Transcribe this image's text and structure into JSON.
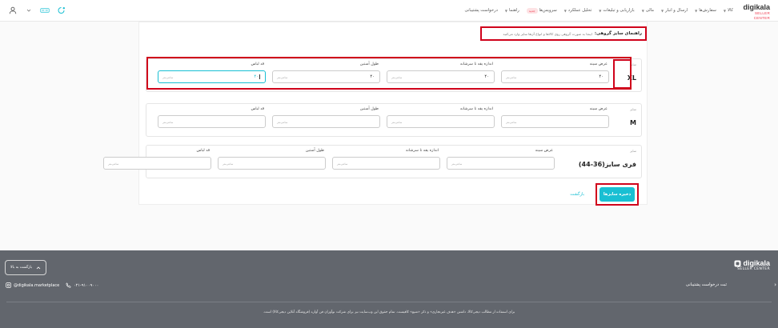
{
  "header": {
    "logo_main": "digikala",
    "logo_sub": "SELLER CENTER",
    "nav": [
      {
        "label": "کالا",
        "chevron": true
      },
      {
        "label": "سفارش‌ها",
        "chevron": true
      },
      {
        "label": "ارسال و انبار",
        "chevron": true
      },
      {
        "label": "مالی",
        "chevron": true
      },
      {
        "label": "بازاریابی و تبلیغات",
        "chevron": true
      },
      {
        "label": "تحلیل عملکرد",
        "chevron": true
      },
      {
        "label": "سرویس‌ها",
        "chevron": false,
        "badge": "جدید"
      },
      {
        "label": "راهنما",
        "chevron": true
      },
      {
        "label": "درخواست پشتیبانی",
        "chevron": false
      }
    ]
  },
  "guide": {
    "title": "راهنمای سایز گروهی:",
    "description": "اینجا به صورت گروهی روی کالاها و انواع آن‌ها سایز وارد می‌کنید"
  },
  "size_caption": "سایز",
  "unit": "سانتی‌متر",
  "sizes": [
    {
      "value": "XL",
      "fields": [
        {
          "label": "عرض سینه",
          "value": "۴۰"
        },
        {
          "label": "اندازه یقه تا سرشانه",
          "value": "۴۰"
        },
        {
          "label": "طول آستین",
          "value": "۴۰"
        },
        {
          "label": "قد لباس",
          "value": "۴۰"
        }
      ]
    },
    {
      "value": "M",
      "fields": [
        {
          "label": "عرض سینه",
          "value": ""
        },
        {
          "label": "اندازه یقه تا سرشانه",
          "value": ""
        },
        {
          "label": "طول آستین",
          "value": ""
        },
        {
          "label": "قد لباس",
          "value": ""
        }
      ]
    },
    {
      "value": "فری سایز(36-44)",
      "fields": [
        {
          "label": "عرض سینه",
          "value": ""
        },
        {
          "label": "اندازه یقه تا سرشانه",
          "value": ""
        },
        {
          "label": "طول آستین",
          "value": ""
        },
        {
          "label": "قد لباس",
          "value": ""
        }
      ]
    }
  ],
  "actions": {
    "save": "ذخیره سایزها",
    "back": "بازگشت"
  },
  "footer": {
    "logo_main": "digikala",
    "logo_sub": "SELLER CENTER",
    "back_to_top": "بازگشت به بالا",
    "support_request": "ثبت درخواست پشتیبانی",
    "instagram": "@digikala.marketplace",
    "phone": "۰۲۱-۹۱۰۰۹۰۰۰",
    "copyright": "برای استفاده از مطالب دیجی‌کالا، داشتن «هدف غیرتجاری» و ذکر «منبع» کافیست. تمام حقوق این وب‌سایت نیز برای شرکت نوآوران فن آوازه (فروشگاه آنلاین دیجی‌کالا) است."
  },
  "colors": {
    "accent": "#19bfd3",
    "brand_red": "#ef394e",
    "highlight": "#d0021b",
    "footer_bg": "#62666d"
  }
}
